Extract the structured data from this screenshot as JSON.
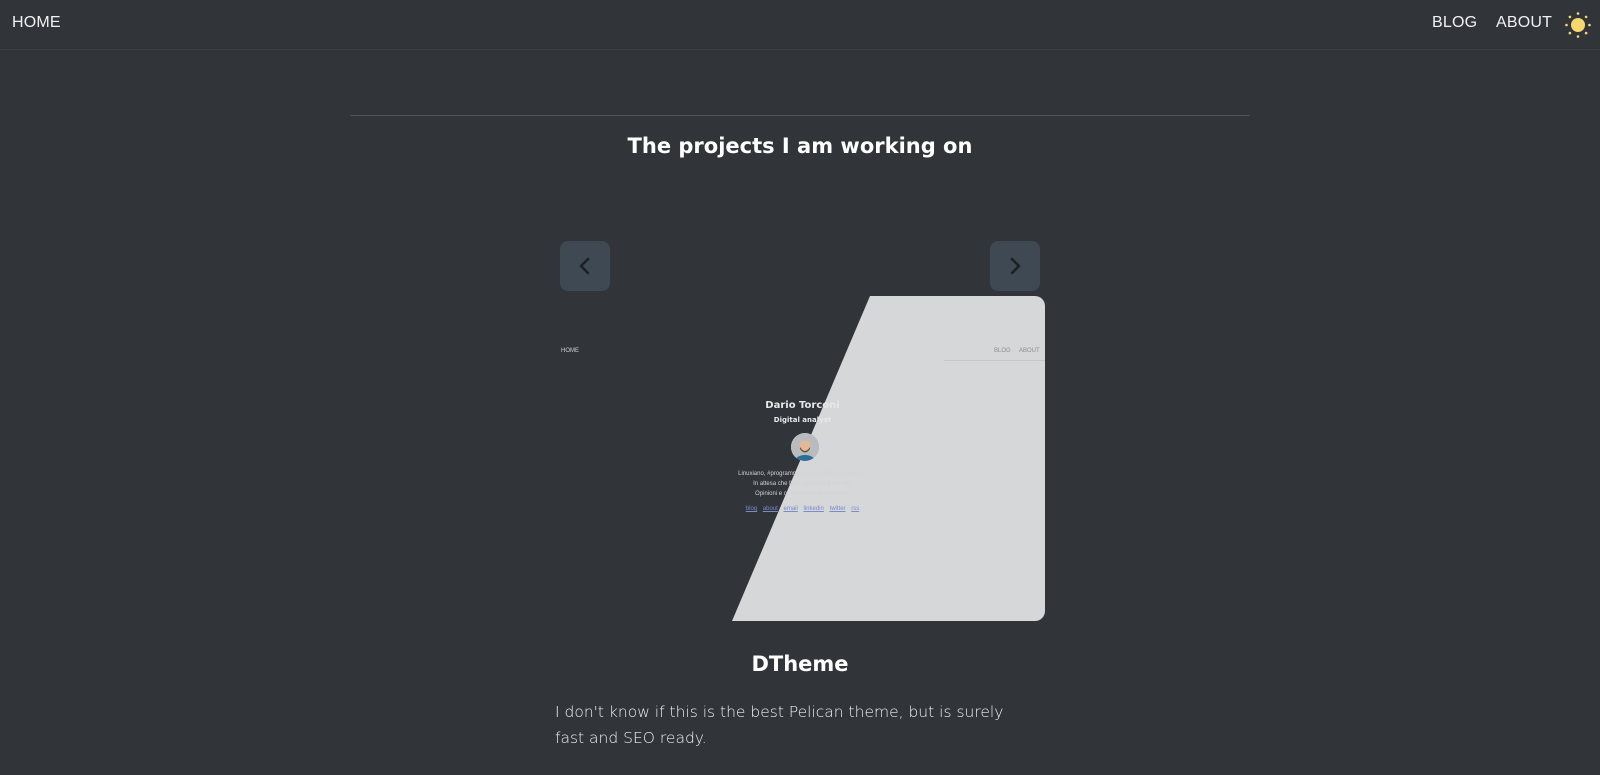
{
  "nav": {
    "home": "HOME",
    "blog": "BLOG",
    "about": "ABOUT",
    "theme_icon": "sun-icon",
    "theme_color": "#f5d76e"
  },
  "section": {
    "title": "The projects I am working on"
  },
  "carousel": {
    "prev_icon": "chevron-left-icon",
    "next_icon": "chevron-right-icon",
    "slide": {
      "preview": {
        "home": "HOME",
        "blog": "BLOG",
        "about": "ABOUT",
        "name": "Dario Torconi",
        "role": "Digital analyst",
        "line1": "Linuxiano, #programmazione, #dati e #analytics.",
        "line2": "In attesa che l'A.I. conquisti il mondo.",
        "line3": "Opinioni e considerazioni personali.",
        "links": [
          "blog",
          "about",
          "email",
          "linkedin",
          "twitter",
          "rss"
        ]
      }
    }
  },
  "project": {
    "title": "DTheme",
    "description": "I don't know if this is the best Pelican theme, but is surely fast and SEO ready."
  }
}
